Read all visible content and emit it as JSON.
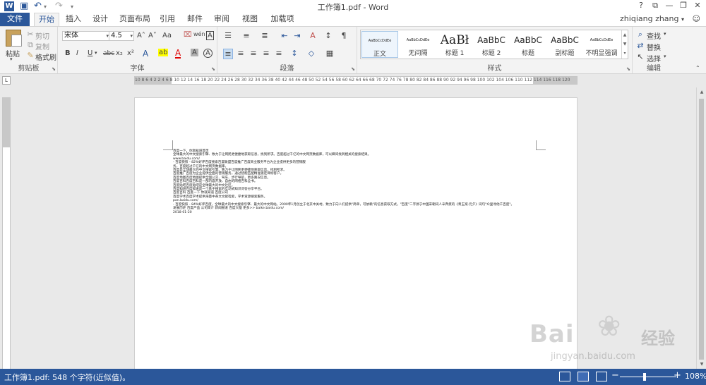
{
  "titlebar": {
    "app_icon": "W",
    "title": "工作簿1.pdf - Word",
    "save_icon": "💾",
    "undo_icon": "↶",
    "redo_icon": "↷",
    "help": "?",
    "ribbon_options": "⧉",
    "minimize": "—",
    "restore": "❐",
    "close": "✕"
  },
  "tabs": [
    "文件",
    "开始",
    "插入",
    "设计",
    "页面布局",
    "引用",
    "邮件",
    "审阅",
    "视图",
    "加载项"
  ],
  "user": "zhiqiang zhang",
  "clipboard": {
    "paste": "粘贴",
    "cut": "剪切",
    "copy": "复制",
    "format_painter": "格式刷",
    "label": "剪贴板"
  },
  "font": {
    "family": "宋体",
    "size": "4.5",
    "grow": "A˄",
    "shrink": "A˅",
    "case": "Aa",
    "clear": "⌫",
    "wen": "wén",
    "border_char": "A",
    "bold": "B",
    "italic": "I",
    "underline": "U",
    "strike": "abc",
    "subscript": "x₂",
    "superscript": "x²",
    "effects": "A",
    "highlight": "ab",
    "color": "A",
    "shade": "A",
    "enclose": "A",
    "label": "字体"
  },
  "paragraph": {
    "bullets": "☰",
    "numbering": "≡",
    "multilevel": "≣",
    "decrease_indent": "⇤",
    "increase_indent": "⇥",
    "chinese_layout": "A",
    "sort": "↕",
    "show_marks": "¶",
    "align_left": "≡",
    "center": "≡",
    "align_right": "≡",
    "justify": "≡",
    "distributed": "≡",
    "line_spacing": "↕",
    "shading": "◇",
    "borders": "▦",
    "label": "段落"
  },
  "styles": {
    "items": [
      {
        "preview": "AaBbCcDdEe",
        "name": "正文"
      },
      {
        "preview": "AaBbCcDdEe",
        "name": "无间隔"
      },
      {
        "preview": "AaBł",
        "name": "标题 1"
      },
      {
        "preview": "AaBbC",
        "name": "标题 2"
      },
      {
        "preview": "AaBbC",
        "name": "标题"
      },
      {
        "preview": "AaBbC",
        "name": "副标题"
      },
      {
        "preview": "AaBbCcDdEe",
        "name": "不明显强调"
      }
    ],
    "label": "样式"
  },
  "editing": {
    "find": "查找",
    "replace": "替换",
    "select": "选择",
    "label": "编辑"
  },
  "ruler": {
    "corner": "L",
    "ticks": "10 8 6 4 2   2  4  6  8 10 12 14 16 18 20 22 24 26 28 30 32 34 36 38 40 42 44 46 48 50 52 54 56 58 60 62 64 66 68 70 72 74 76 78 80 82 84 86 88 90 92 94 96 98 100 102 104 106   110 112 114 116 118 120"
  },
  "document": {
    "paragraphs": [
      "百度一下，你就知道首页",
      "全球最大的中文搜索引擎、致力于让网民更便捷地获取信息，找到所求。百度超过千亿的中文网页数据库，可以瞬间找到相关的搜索结果。",
      "www.baidu.com/",
      "- 百度快照 - 82%好评百度搜索百度联盟百度推广百度商业服务平台为企业提供更多的营销服务，百度超过千亿的中文网页数据库。",
      "百度是全球最大的中文搜索引擎、致力于让网民更便捷地获取信息，找到所求。",
      "百度推广百度为企业提供全面的营销服务，通过智能匹配精准锁定目标客户。",
      "百度地图百度地图提供全国公交、驾车、步行导航，更多路况信息。",
      "百度百科百度百科是一部内容开放、自由的网络百科全书。",
      "百度贴吧百度贴吧是全球最大的中文社区。",
      "百度知道百度知道是一个基于搜索的互动式知识问答分享平台。",
      "百度百科 百度一下 你就知道 百度公司",
      "百度学术百度学术提供海量中英文文献检索，学术资源搜索服务。",
      "pan.baidu.com/",
      "- 百度快照 - 84%好评百度，全球最大的中文搜索引擎、最大的中文网站。2000年1月创立于北京中关村。致力于向人们提供\"简单，可依赖\"的信息获取方式。\"百度\"二字源于中国宋朝词人辛弃疾的《青玉案·元夕》词句\"众里寻他千百度\"。",
      "发展历史 百度产品 公司简介 新闻报道 百度大脑 更多>> baike.baidu.com/",
      "2018-01-20"
    ]
  },
  "status": {
    "text": "工作簿1.pdf: 548 个字符(近似值)。",
    "zoom": "108%",
    "zoom_minus": "−",
    "zoom_plus": "+"
  },
  "watermark": {
    "brand": "Bai",
    "paw": "🐾",
    "jingyan": "经验",
    "url": "jingyan.baidu.com"
  },
  "colors": {
    "accent": "#2b579a",
    "highlight": "#ffff00",
    "font_color": "#e00000"
  }
}
